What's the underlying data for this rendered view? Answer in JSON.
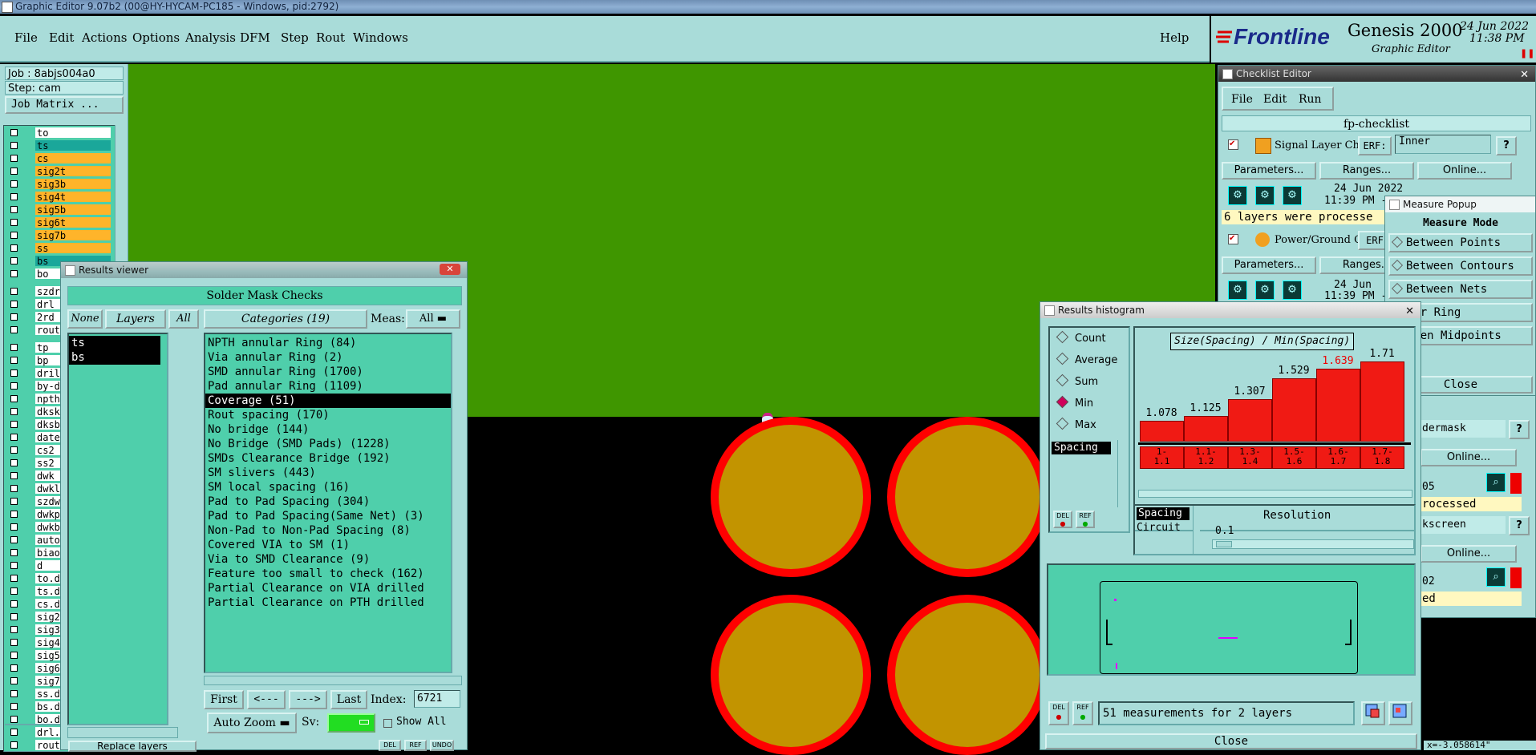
{
  "titlebar": {
    "text": "Graphic Editor 9.07b2 (00@HY-HYCAM-PC185 - Windows, pid:2792)"
  },
  "menu": {
    "items": [
      "File",
      "Edit",
      "Actions",
      "Options",
      "Analysis",
      "DFM",
      "Step",
      "Rout",
      "Windows"
    ],
    "help": "Help"
  },
  "brand": {
    "logo": "Frontline",
    "product": "Genesis 2000",
    "subtitle": "Graphic Editor",
    "date": "24 Jun 2022",
    "time": "11:38 PM"
  },
  "left": {
    "job": "Job : 8abjs004a0",
    "step": "Step: cam",
    "job_matrix": "Job Matrix ...",
    "layers": [
      {
        "name": "to",
        "color": "#ffffff"
      },
      {
        "name": "ts",
        "color": "#1aa79a"
      },
      {
        "name": "cs",
        "color": "#ffb42a"
      },
      {
        "name": "sig2t",
        "color": "#ffb42a"
      },
      {
        "name": "sig3b",
        "color": "#ffb42a"
      },
      {
        "name": "sig4t",
        "color": "#ffb42a"
      },
      {
        "name": "sig5b",
        "color": "#ffb42a"
      },
      {
        "name": "sig6t",
        "color": "#ffb42a"
      },
      {
        "name": "sig7b",
        "color": "#ffb42a"
      },
      {
        "name": "ss",
        "color": "#ffb42a"
      },
      {
        "name": "bs",
        "color": "#1aa79a"
      },
      {
        "name": "bo",
        "color": "#ffffff"
      }
    ],
    "layers2": [
      "szdr",
      "drl",
      "2rd",
      "rout"
    ],
    "layers3": [
      "tp",
      "bp",
      "dril",
      "by-d",
      "npth",
      "dksk",
      "dksb",
      "date",
      "cs2",
      "ss2",
      "dwk",
      "dwkl",
      "szdw",
      "dwkp",
      "dwkb",
      "auto",
      "biao",
      "d",
      "to.d",
      "ts.d",
      "cs.d",
      "sig2",
      "sig3",
      "sig4",
      "sig5",
      "sig6",
      "sig7",
      "ss.d",
      "bs.d",
      "bo.d",
      "drl.",
      "rout"
    ],
    "replace": "Replace layers"
  },
  "results_viewer": {
    "title": "Results viewer",
    "header": "Solder Mask Checks",
    "btn_none": "None",
    "btn_layers": "Layers",
    "btn_all": "All",
    "categories_label": "Categories (19)",
    "meas_label": "Meas:",
    "meas_value": "All",
    "layer_list": [
      "ts",
      "bs"
    ],
    "categories": [
      "NPTH annular Ring (84)",
      "Via annular Ring (2)",
      "SMD annular Ring (1700)",
      "Pad annular Ring (1109)",
      "Coverage (51)",
      "Rout spacing (170)",
      "No bridge (144)",
      "No Bridge (SMD Pads) (1228)",
      "SMDs Clearance Bridge (192)",
      "SM slivers (443)",
      "SM local spacing (16)",
      "Pad to Pad Spacing (304)",
      "Pad to Pad Spacing(Same Net) (3)",
      "Non-Pad to Non-Pad Spacing (8)",
      "Covered VIA to SM (1)",
      "Via to SMD Clearance (9)",
      "Feature too small to check (162)",
      "Partial Clearance on VIA drilled",
      "Partial Clearance on PTH drilled"
    ],
    "selected_index": 4,
    "nav": {
      "first": "First",
      "prev": "<---",
      "next": "--->",
      "last": "Last",
      "index_label": "Index:",
      "index_value": "6721"
    },
    "auto_zoom": "Auto Zoom",
    "sv_label": "Sv:",
    "show_all": "Show All",
    "bottom_btns": [
      "DEL",
      "REF",
      "UNDO"
    ]
  },
  "histogram": {
    "title": "Results histogram",
    "modes": [
      "Count",
      "Average",
      "Sum",
      "Min",
      "Max"
    ],
    "selected_mode": "Min",
    "list_item": "Spacing",
    "chart_title": "Size(Spacing) / Min(Spacing)",
    "bins": [
      {
        "label": "1-\n1.1",
        "value": 1.078,
        "text": "1.078"
      },
      {
        "label": "1.1-\n1.2",
        "value": 1.125,
        "text": "1.125"
      },
      {
        "label": "1.3-\n1.4",
        "value": 1.307,
        "text": "1.307"
      },
      {
        "label": "1.5-\n1.6",
        "value": 1.529,
        "text": "1.529"
      },
      {
        "label": "1.6-\n1.7",
        "value": 1.639,
        "text": "1.639",
        "highlight": true
      },
      {
        "label": "1.7-\n1.8",
        "value": 1.71,
        "text": "1.71"
      }
    ],
    "attr_list": [
      "Spacing",
      "Circuit"
    ],
    "resolution_label": "Resolution",
    "resolution_value": "0.1",
    "small_btns": [
      "DEL",
      "REF"
    ],
    "status": "51 measurements for 2 layers",
    "close": "Close"
  },
  "checklist": {
    "title": "Checklist Editor",
    "menu": [
      "File",
      "Edit",
      "Run"
    ],
    "name": "fp-checklist",
    "items": [
      {
        "name": "Signal Layer Ch",
        "erf_label": "ERF:",
        "erf_value": "Inner",
        "date": "24 Jun 2022",
        "time": "11:39 PM -",
        "status": "6 layers were processe"
      },
      {
        "name": "Power/Ground C",
        "erf_label": "ERF",
        "date": "24 Jun",
        "time": "11:39 PM -"
      }
    ],
    "row_btns": [
      "Parameters...",
      "Ranges...",
      "Online..."
    ],
    "partials": [
      "dermask",
      "Online...",
      "05",
      "rocessed",
      "kscreen",
      "Online...",
      "02",
      "ed"
    ]
  },
  "measure": {
    "title": "Measure Popup",
    "header": "Measure Mode",
    "items": [
      "Between Points",
      "Between Contours",
      "Between Nets",
      "nular Ring",
      "etween Midpoints"
    ],
    "close": "Close"
  },
  "coords": "x=-3.058614\""
}
